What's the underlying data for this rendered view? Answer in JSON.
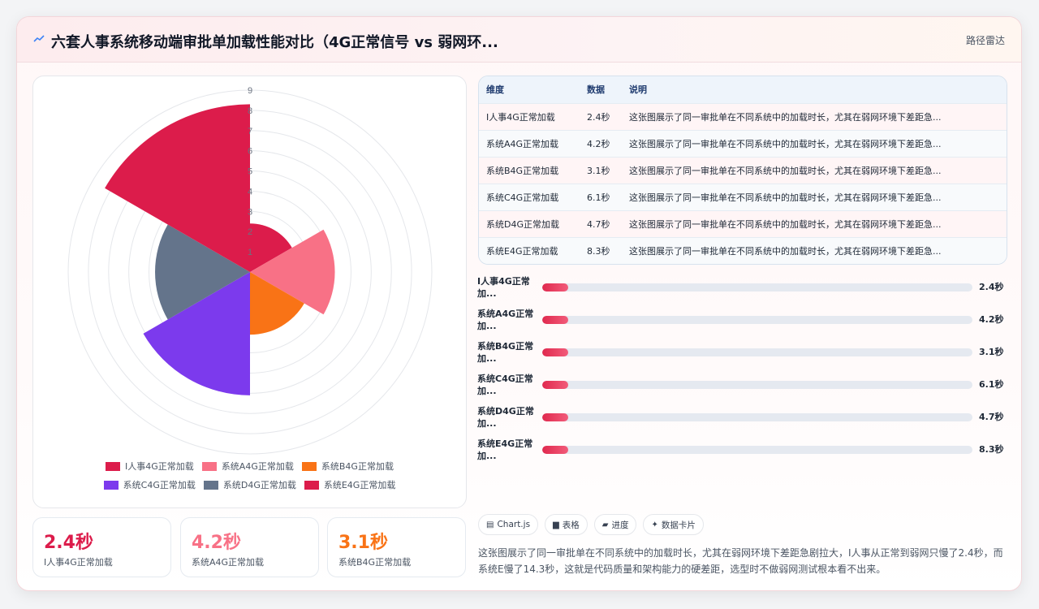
{
  "header": {
    "icon": "trend-icon",
    "title": "六套人事系统移动端审批单加载性能对比（4G正常信号 vs 弱网环...",
    "link_label": "路径雷达"
  },
  "colors": {
    "crimson": "#dc1c4b",
    "pink": "#f87186",
    "orange": "#f97316",
    "purple": "#7c3aed",
    "slate": "#64748b"
  },
  "chart_data": {
    "type": "polar-area",
    "title": "",
    "categories": [
      "I人事4G正常加载",
      "系统A4G正常加载",
      "系统B4G正常加载",
      "系统C4G正常加载",
      "系统D4G正常加载",
      "系统E4G正常加载"
    ],
    "values": [
      2.4,
      4.2,
      3.1,
      6.1,
      4.7,
      8.3
    ],
    "colors": [
      "#dc1c4b",
      "#f87186",
      "#f97316",
      "#7c3aed",
      "#64748b",
      "#dc1c4b"
    ],
    "radial_ticks": [
      "1",
      "2",
      "3",
      "4",
      "5",
      "6",
      "7",
      "8",
      "9"
    ],
    "rlim": [
      0,
      9
    ],
    "grid": true,
    "legend": "bottom"
  },
  "stats": [
    {
      "value": "2.4秒",
      "label": "I人事4G正常加载",
      "color": "#dc1c4b"
    },
    {
      "value": "4.2秒",
      "label": "系统A4G正常加载",
      "color": "#f87186"
    },
    {
      "value": "3.1秒",
      "label": "系统B4G正常加载",
      "color": "#f97316"
    }
  ],
  "table": {
    "headers": [
      "维度",
      "数据",
      "说明"
    ],
    "rows": [
      [
        "I人事4G正常加载",
        "2.4秒",
        "这张图展示了同一审批单在不同系统中的加载时长，尤其在弱网环境下差距急..."
      ],
      [
        "系统A4G正常加载",
        "4.2秒",
        "这张图展示了同一审批单在不同系统中的加载时长，尤其在弱网环境下差距急..."
      ],
      [
        "系统B4G正常加载",
        "3.1秒",
        "这张图展示了同一审批单在不同系统中的加载时长，尤其在弱网环境下差距急..."
      ],
      [
        "系统C4G正常加载",
        "6.1秒",
        "这张图展示了同一审批单在不同系统中的加载时长，尤其在弱网环境下差距急..."
      ],
      [
        "系统D4G正常加载",
        "4.7秒",
        "这张图展示了同一审批单在不同系统中的加载时长，尤其在弱网环境下差距急..."
      ],
      [
        "系统E4G正常加载",
        "8.3秒",
        "这张图展示了同一审批单在不同系统中的加载时长，尤其在弱网环境下差距急..."
      ]
    ]
  },
  "progress": [
    {
      "label": "I人事4G正常加...",
      "value": "2.4秒",
      "fill": 0.06
    },
    {
      "label": "系统A4G正常加...",
      "value": "4.2秒",
      "fill": 0.06
    },
    {
      "label": "系统B4G正常加...",
      "value": "3.1秒",
      "fill": 0.06
    },
    {
      "label": "系统C4G正常加...",
      "value": "6.1秒",
      "fill": 0.06
    },
    {
      "label": "系统D4G正常加...",
      "value": "4.7秒",
      "fill": 0.06
    },
    {
      "label": "系统E4G正常加...",
      "value": "8.3秒",
      "fill": 0.06
    }
  ],
  "chips": [
    {
      "icon": "chart-icon",
      "glyph": "▤",
      "label": "Chart.js"
    },
    {
      "icon": "table-icon",
      "glyph": "▆",
      "label": "表格"
    },
    {
      "icon": "progress-icon",
      "glyph": "▰",
      "label": "进度"
    },
    {
      "icon": "sparkle-icon",
      "glyph": "✦",
      "label": "数据卡片"
    }
  ],
  "description": "这张图展示了同一审批单在不同系统中的加载时长，尤其在弱网环境下差距急剧拉大，I人事从正常到弱网只慢了2.4秒，而系统E慢了14.3秒，这就是代码质量和架构能力的硬差距，选型时不做弱网测试根本看不出来。"
}
